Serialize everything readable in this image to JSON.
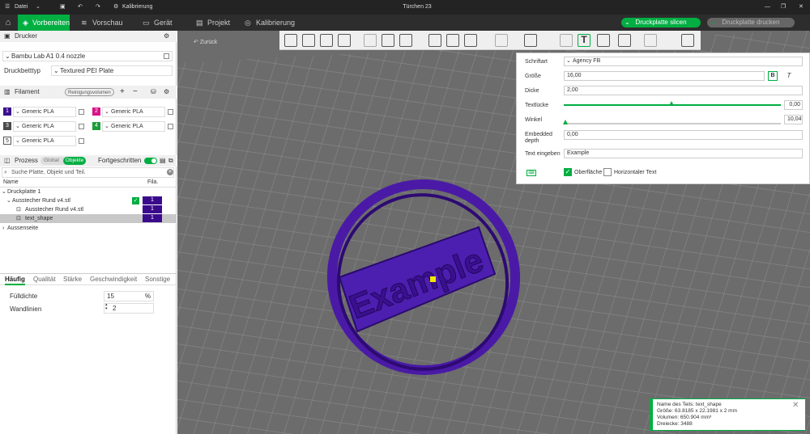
{
  "titlebar": {
    "menu_label": "Datei",
    "calibration_label": "Kalibrierung",
    "doc_title": "Türchen 23"
  },
  "tabs": [
    {
      "label": "Vorbereiten"
    },
    {
      "label": "Vorschau"
    },
    {
      "label": "Gerät"
    },
    {
      "label": "Projekt"
    },
    {
      "label": "Kalibrierung"
    }
  ],
  "actions": {
    "slice_label": "Druckplatte slicen",
    "print_label": "Druckplatte drucken"
  },
  "printer": {
    "section_title": "Drucker",
    "printer_name": "Bambu Lab A1 0.4 nozzle",
    "bed_type_label": "Druckbetttyp",
    "bed_type_value": "Textured PEI Plate"
  },
  "filament": {
    "section_title": "Filament",
    "flush_button": "Reinigungsvolumen",
    "slots": [
      {
        "num": "1",
        "name": "Generic PLA",
        "color": "#3b0f8c"
      },
      {
        "num": "2",
        "name": "Generic PLA",
        "color": "#d9138a"
      },
      {
        "num": "3",
        "name": "Generic PLA",
        "color": "#4a4a4a"
      },
      {
        "num": "4",
        "name": "Generic PLA",
        "color": "#1a9e3a"
      },
      {
        "num": "5",
        "name": "Generic PLA",
        "color": "#ffffff"
      }
    ]
  },
  "process": {
    "section_title": "Prozess",
    "toggle_global": "Global",
    "toggle_objects": "Objekte",
    "advanced_label": "Fortgeschritten",
    "search_placeholder": "Suche Platte, Objekt und Teil.",
    "col_name": "Name",
    "col_fila": "Fila.",
    "tree": [
      {
        "label": "Druckplatte 1",
        "fila": ""
      },
      {
        "label": "Ausstecher Rund v4.stl",
        "fila": "1"
      },
      {
        "label": "Ausstecher Rund v4.stl",
        "fila": "1"
      },
      {
        "label": "text_shape",
        "fila": "1"
      },
      {
        "label": "Aussenseite",
        "fila": ""
      }
    ]
  },
  "settings_tabs": [
    {
      "label": "Häufig"
    },
    {
      "label": "Qualität"
    },
    {
      "label": "Stärke"
    },
    {
      "label": "Geschwindigkeit"
    },
    {
      "label": "Sonstige"
    }
  ],
  "settings": {
    "infill_label": "Fülldichte",
    "infill_value": "15",
    "infill_unit": "%",
    "walls_label": "Wandlinien",
    "walls_value": "2"
  },
  "viewport": {
    "back_label": "Zurück",
    "model_text": "Example"
  },
  "text_tool": {
    "font_label": "Schriftart",
    "font_value": "Agency FB",
    "size_label": "Größe",
    "size_value": "16,00",
    "bold_label": "B",
    "italic_label": "T",
    "thickness_label": "Dicke",
    "thickness_value": "2,00",
    "gap_label": "Textlücke",
    "gap_value": "0,00",
    "angle_label": "Winkel",
    "angle_value": "10,04",
    "depth_label": "Embedded depth",
    "depth_value": "0,00",
    "text_label": "Text eingeben",
    "text_value": "Example",
    "surface_label": "Oberfläche",
    "horizontal_label": "Horizontaler Text"
  },
  "info": {
    "line1": "Name des Teils: text_shape",
    "line2": "Größe: 63.8185 x 22.1981 x 2 mm",
    "line3": "Volumen: 650.904 mm³",
    "line4": "Dreiecke: 3488"
  }
}
